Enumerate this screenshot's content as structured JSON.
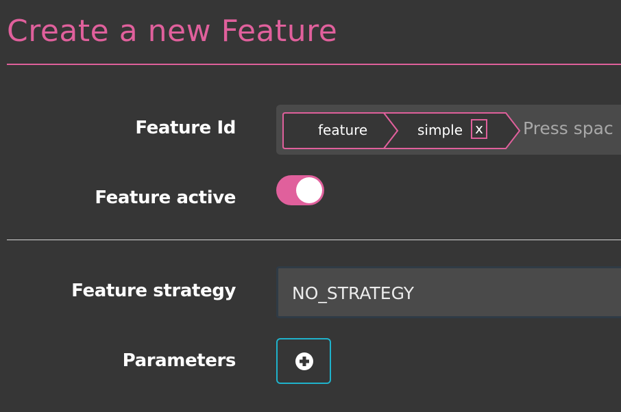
{
  "page": {
    "title": "Create a new Feature"
  },
  "form": {
    "feature_id": {
      "label": "Feature Id",
      "tags": [
        "feature",
        "simple"
      ],
      "remove_label": "x",
      "placeholder": "Press spac"
    },
    "feature_active": {
      "label": "Feature active",
      "enabled": true
    },
    "feature_strategy": {
      "label": "Feature strategy",
      "value": "NO_STRATEGY"
    },
    "parameters": {
      "label": "Parameters",
      "add_icon": "plus-circle-icon"
    }
  },
  "colors": {
    "accent": "#e0609c",
    "background": "#363636",
    "field": "#4a4a4a",
    "button_border": "#1fb3cc"
  }
}
